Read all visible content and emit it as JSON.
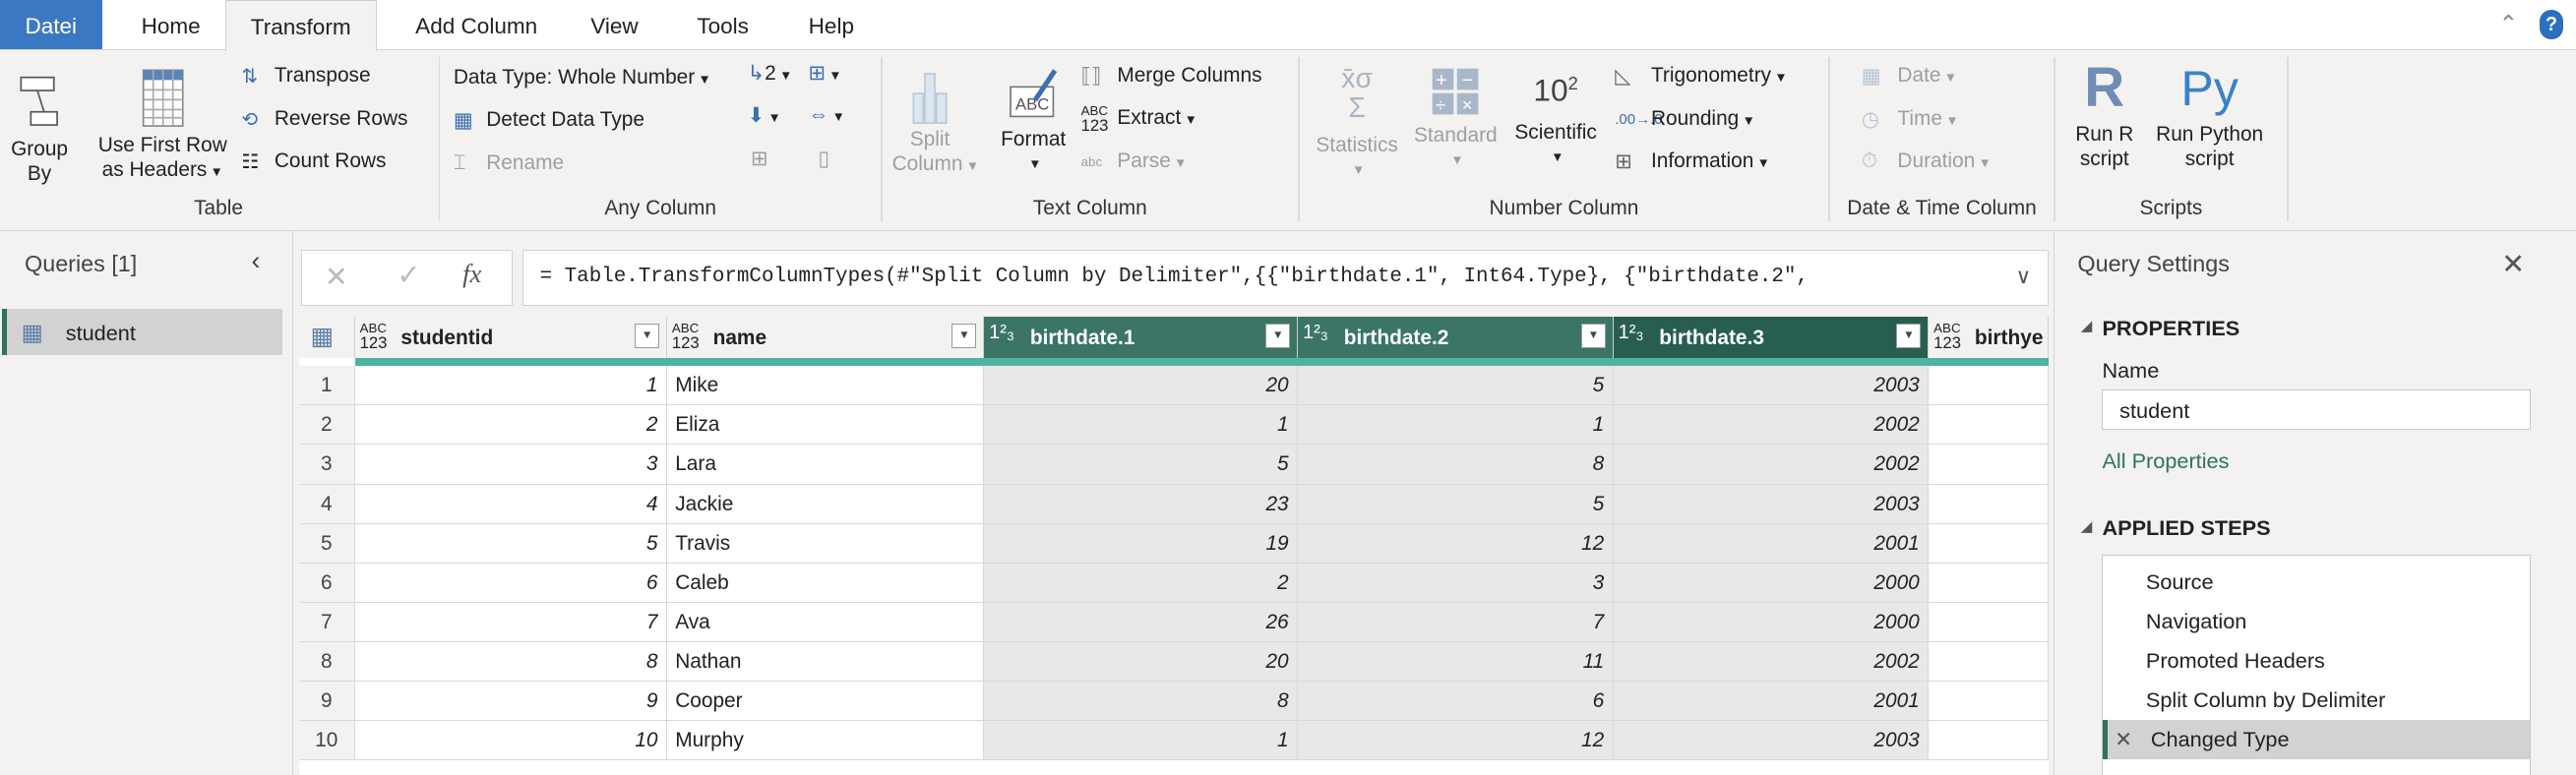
{
  "tabs": {
    "file": "Datei",
    "home": "Home",
    "transform": "Transform",
    "add_column": "Add Column",
    "view": "View",
    "tools": "Tools",
    "help": "Help"
  },
  "ribbon": {
    "table": {
      "label": "Table",
      "group_by_1": "Group",
      "group_by_2": "By",
      "first_row_1": "Use First Row",
      "first_row_2": "as Headers",
      "transpose": "Transpose",
      "reverse_rows": "Reverse Rows",
      "count_rows": "Count Rows"
    },
    "any_column": {
      "label": "Any Column",
      "data_type": "Data Type: Whole Number",
      "detect": "Detect Data Type",
      "rename": "Rename",
      "replace_sub": "2"
    },
    "text_column": {
      "label": "Text Column",
      "split_1": "Split",
      "split_2": "Column",
      "format": "Format",
      "merge": "Merge Columns",
      "extract": "Extract",
      "parse": "Parse",
      "abc": "ABC",
      "n123": "123",
      "abc_small": "abc"
    },
    "number_column": {
      "label": "Number Column",
      "statistics": "Statistics",
      "standard": "Standard",
      "scientific": "Scientific",
      "sci_glyph": "10",
      "sci_exp": "2",
      "trig": "Trigonometry",
      "rounding": "Rounding",
      "information": "Information"
    },
    "datetime": {
      "label": "Date & Time Column",
      "date": "Date",
      "time": "Time",
      "duration": "Duration"
    },
    "scripts": {
      "label": "Scripts",
      "r_glyph": "R",
      "py_glyph": "Py",
      "run_r_1": "Run R",
      "run_r_2": "script",
      "run_py_1": "Run Python",
      "run_py_2": "script"
    }
  },
  "queries": {
    "title": "Queries [1]",
    "items": [
      {
        "name": "student"
      }
    ]
  },
  "formula": {
    "text": "= Table.TransformColumnTypes(#\"Split Column by Delimiter\",{{\"birthdate.1\", Int64.Type}, {\"birthdate.2\",",
    "fx": "fx"
  },
  "columns": [
    {
      "name": "studentid",
      "type": "any"
    },
    {
      "name": "name",
      "type": "any"
    },
    {
      "name": "birthdate.1",
      "type": "int"
    },
    {
      "name": "birthdate.2",
      "type": "int"
    },
    {
      "name": "birthdate.3",
      "type": "int"
    },
    {
      "name": "birthye",
      "type": "any"
    }
  ],
  "type_labels": {
    "any_top": "ABC",
    "any_bottom": "123",
    "int": "1²₃"
  },
  "rows": [
    [
      "1",
      "Mike",
      "20",
      "5",
      "2003"
    ],
    [
      "2",
      "Eliza",
      "1",
      "1",
      "2002"
    ],
    [
      "3",
      "Lara",
      "5",
      "8",
      "2002"
    ],
    [
      "4",
      "Jackie",
      "23",
      "5",
      "2003"
    ],
    [
      "5",
      "Travis",
      "19",
      "12",
      "2001"
    ],
    [
      "6",
      "Caleb",
      "2",
      "3",
      "2000"
    ],
    [
      "7",
      "Ava",
      "26",
      "7",
      "2000"
    ],
    [
      "8",
      "Nathan",
      "20",
      "11",
      "2002"
    ],
    [
      "9",
      "Cooper",
      "8",
      "6",
      "2001"
    ],
    [
      "10",
      "Murphy",
      "1",
      "12",
      "2003"
    ]
  ],
  "settings": {
    "title": "Query Settings",
    "properties": "PROPERTIES",
    "name_label": "Name",
    "name_value": "student",
    "all_properties": "All Properties",
    "applied_steps": "APPLIED STEPS",
    "steps": [
      "Source",
      "Navigation",
      "Promoted Headers",
      "Split Column by Delimiter",
      "Changed Type"
    ]
  },
  "colors": {
    "accent": "#2e7260",
    "header_num": "#3a7566",
    "header_active": "#275e4f",
    "quality_bar": "#4fb3a2",
    "file_tab": "#3b78c4"
  }
}
